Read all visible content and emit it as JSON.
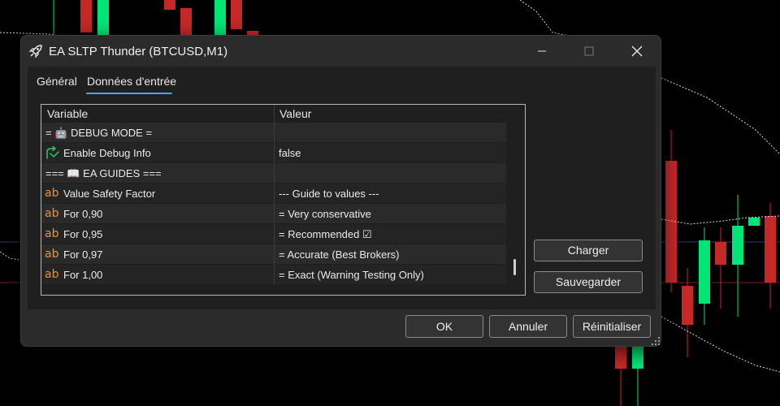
{
  "window": {
    "title": "EA SLTP Thunder (BTCUSD,M1)",
    "icon": "rocket-icon"
  },
  "tabs": [
    {
      "label": "Général",
      "active": false
    },
    {
      "label": "Données d'entrée",
      "active": true
    }
  ],
  "grid": {
    "headers": {
      "variable": "Variable",
      "value": "Valeur"
    },
    "rows": [
      {
        "icon": "none",
        "variable": "= 🤖 DEBUG MODE =",
        "value": ""
      },
      {
        "icon": "boolean-arrow-icon",
        "variable": "Enable Debug Info",
        "value": "false"
      },
      {
        "icon": "none",
        "variable": "=== 📖 EA GUIDES ===",
        "value": ""
      },
      {
        "icon": "string-ab-icon",
        "variable": "Value Safety Factor",
        "value": "--- Guide to values ---"
      },
      {
        "icon": "string-ab-icon",
        "variable": "For 0,90",
        "value": "= Very conservative"
      },
      {
        "icon": "string-ab-icon",
        "variable": "For 0,95",
        "value": "= Recommended ☑"
      },
      {
        "icon": "string-ab-icon",
        "variable": "For 0,97",
        "value": "= Accurate (Best Brokers)"
      },
      {
        "icon": "string-ab-icon",
        "variable": "For 1,00",
        "value": "= Exact (Warning Testing Only)"
      }
    ]
  },
  "side_buttons": {
    "load": "Charger",
    "save": "Sauvegarder"
  },
  "footer_buttons": {
    "ok": "OK",
    "cancel": "Annuler",
    "reset": "Réinitialiser"
  },
  "colors": {
    "accent": "#4aa3ff",
    "string_icon": "#e8923a",
    "bool_icon": "#2ecc71",
    "candle_up": "#00e676",
    "candle_down": "#c62828"
  }
}
